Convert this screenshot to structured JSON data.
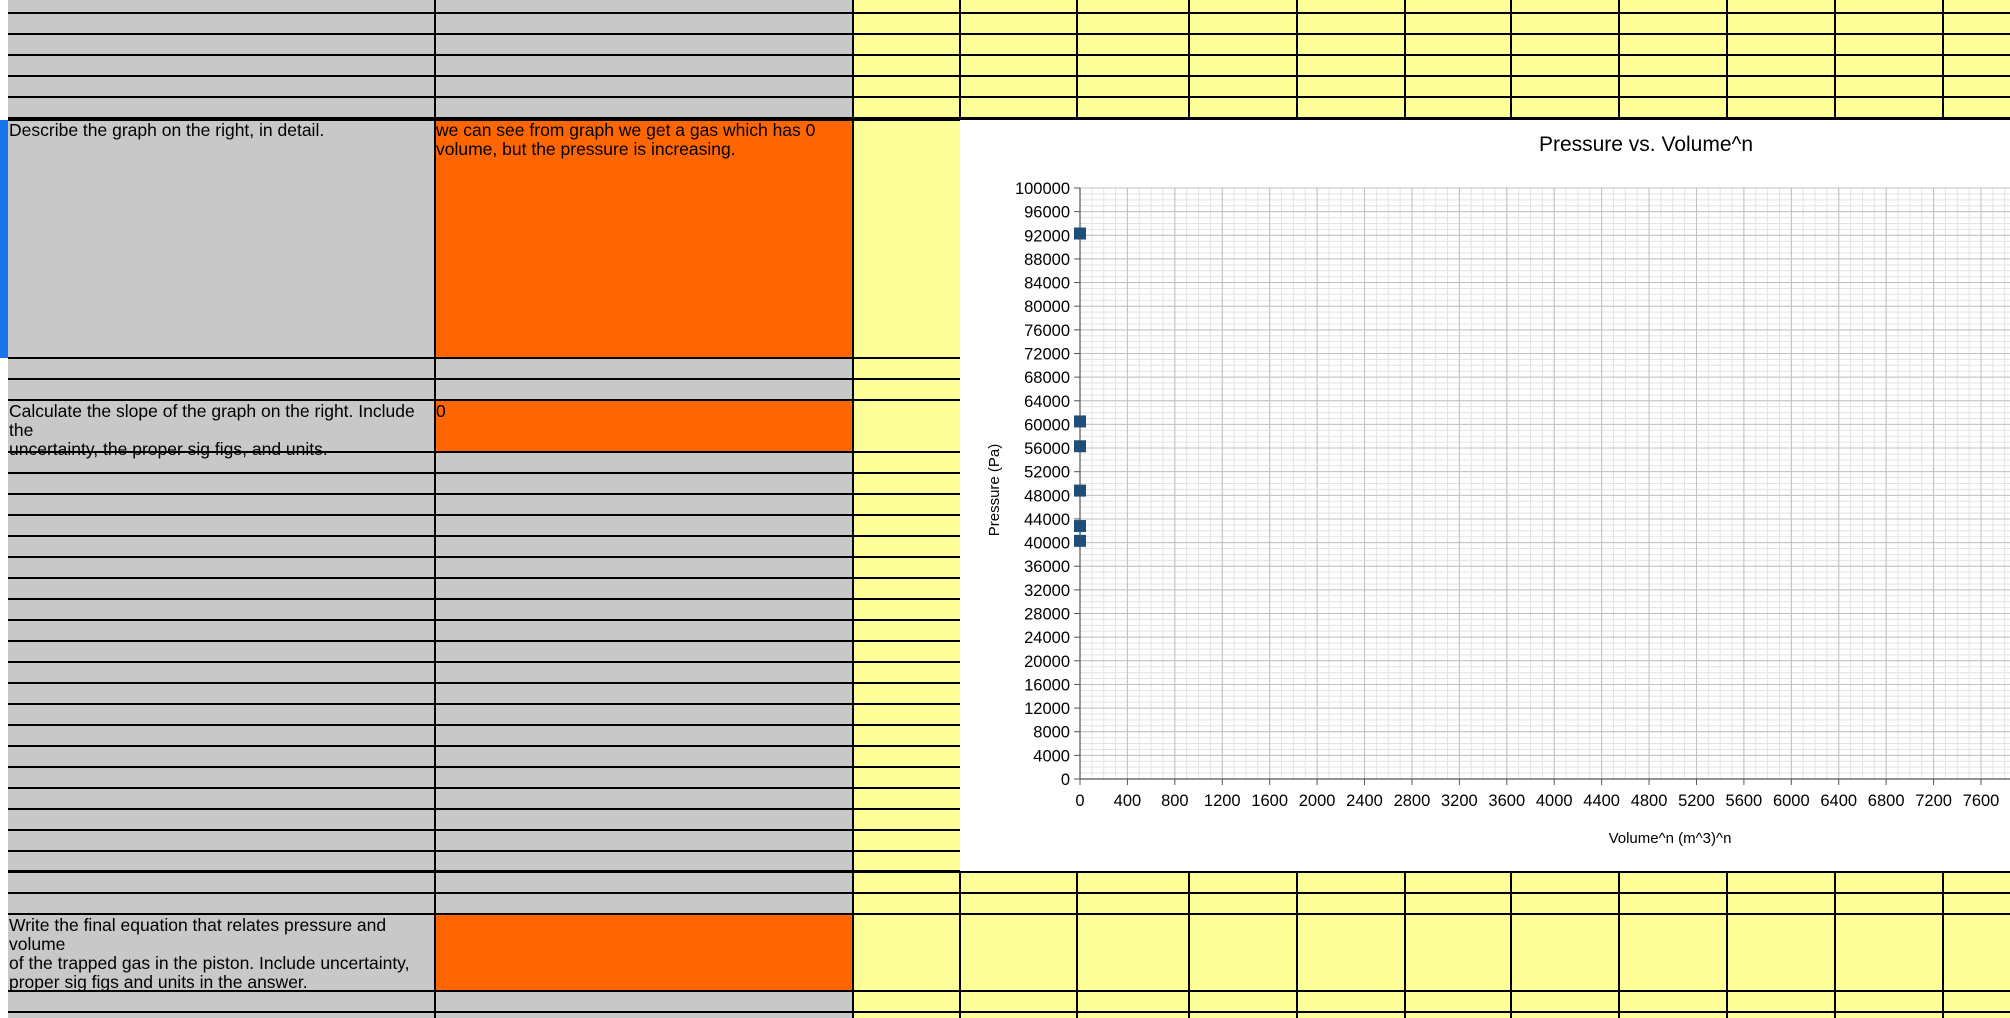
{
  "colors": {
    "label_bg": "#c8c8c8",
    "answer_bg": "#ff6600",
    "yellow_bg": "#ffff99",
    "grid_line": "#000000",
    "marker": "#1f4e79",
    "selection": "#1a73e8"
  },
  "rows": {
    "describe": {
      "label": "Describe the graph on the right, in detail.",
      "answer": "we can see from graph we get a gas which has 0\nvolume, but the pressure is increasing."
    },
    "slope": {
      "label": "Calculate the slope of the graph on the right. Include the\nuncertainty, the proper sig figs, and units.",
      "answer": "0"
    },
    "equation": {
      "label": "Write the final equation that relates pressure and volume\nof the trapped gas in the piston. Include  uncertainty,\nproper sig figs and units in the answer.",
      "answer": ""
    }
  },
  "chart_data": {
    "type": "scatter",
    "title": "Pressure vs. Volume^n",
    "xlabel": "Volume^n (m^3)^n",
    "ylabel": "Pressure (Pa)",
    "xlim": [
      0,
      7600
    ],
    "ylim": [
      0,
      100000
    ],
    "x_ticks": [
      0,
      400,
      800,
      1200,
      1600,
      2000,
      2400,
      2800,
      3200,
      3600,
      4000,
      4400,
      4800,
      5200,
      5600,
      6000,
      6400,
      6800,
      7200,
      7600
    ],
    "y_ticks": [
      0,
      4000,
      8000,
      12000,
      16000,
      20000,
      24000,
      28000,
      32000,
      36000,
      40000,
      44000,
      48000,
      52000,
      56000,
      60000,
      64000,
      68000,
      72000,
      76000,
      80000,
      84000,
      88000,
      92000,
      96000,
      100000
    ],
    "grid": true,
    "series": [
      {
        "marker": "square",
        "points": [
          {
            "x": 0,
            "y": 92300
          },
          {
            "x": 0,
            "y": 60500
          },
          {
            "x": 0,
            "y": 56300
          },
          {
            "x": 0,
            "y": 48800
          },
          {
            "x": 0,
            "y": 42800
          },
          {
            "x": 0,
            "y": 40300
          }
        ]
      }
    ]
  }
}
